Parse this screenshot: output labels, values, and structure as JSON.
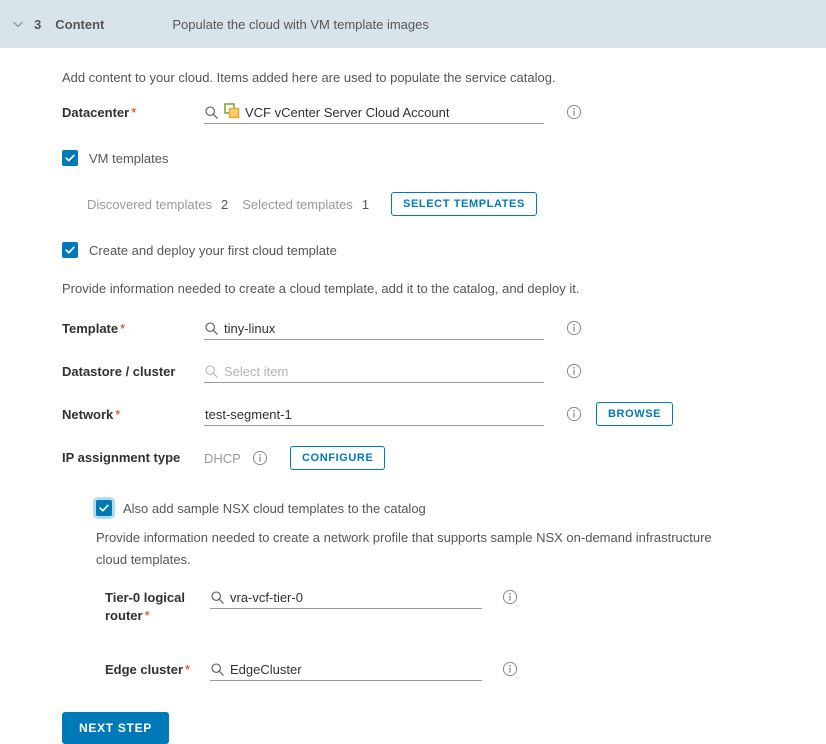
{
  "step_header": {
    "chevron_icon": "chevron-down-icon",
    "number": "3",
    "title": "Content",
    "description": "Populate the cloud with VM template images"
  },
  "intro_text": "Add content to your cloud. Items added here are used to populate the service catalog.",
  "datacenter": {
    "label": "Datacenter",
    "required": "*",
    "search_icon": "search-icon",
    "badge_icon": "vcenter-account-icon",
    "value": "VCF vCenter Server Cloud Account",
    "info_icon": "info-icon"
  },
  "vm_templates": {
    "checkbox_label": "VM templates",
    "checked": true,
    "discovered_label": "Discovered templates",
    "discovered_count": "2",
    "selected_label": "Selected templates",
    "selected_count": "1",
    "select_button": "SELECT TEMPLATES"
  },
  "cloud_template": {
    "checkbox_label": "Create and deploy your first cloud template",
    "checked": true,
    "description": "Provide information needed to create a cloud template, add it to the catalog, and deploy it.",
    "fields": {
      "template": {
        "label": "Template",
        "required": "*",
        "value": "tiny-linux",
        "placeholder": "",
        "search_icon": "search-icon",
        "info_icon": "info-icon"
      },
      "datastore": {
        "label": "Datastore / cluster",
        "required": "",
        "value": "",
        "placeholder": "Select item",
        "search_icon": "search-icon",
        "info_icon": "info-icon"
      },
      "network": {
        "label": "Network",
        "required": "*",
        "value": "test-segment-1",
        "placeholder": "",
        "info_icon": "info-icon",
        "browse_button": "BROWSE"
      },
      "ip_assignment": {
        "label": "IP assignment type",
        "value": "DHCP",
        "info_icon": "info-icon",
        "configure_button": "CONFIGURE"
      }
    }
  },
  "nsx": {
    "checkbox_label": "Also add sample NSX cloud templates to the catalog",
    "checked": true,
    "focused": true,
    "description": "Provide information needed to create a network profile that supports sample NSX on-demand infrastructure cloud templates.",
    "tier0": {
      "label": "Tier-0 logical router",
      "required": "*",
      "value": "vra-vcf-tier-0",
      "search_icon": "search-icon",
      "info_icon": "info-icon"
    },
    "edge_cluster": {
      "label": "Edge cluster",
      "required": "*",
      "value": "EdgeCluster",
      "search_icon": "search-icon",
      "info_icon": "info-icon"
    }
  },
  "next_step_button": "NEXT STEP",
  "colors": {
    "accent": "#0079b8",
    "header_bg": "#d9e4ea",
    "required_star": "#e62700",
    "label_text": "#313131",
    "body_text": "#565656",
    "muted_text": "#9a9a9a",
    "focus_ring": "#b3dcf3"
  }
}
